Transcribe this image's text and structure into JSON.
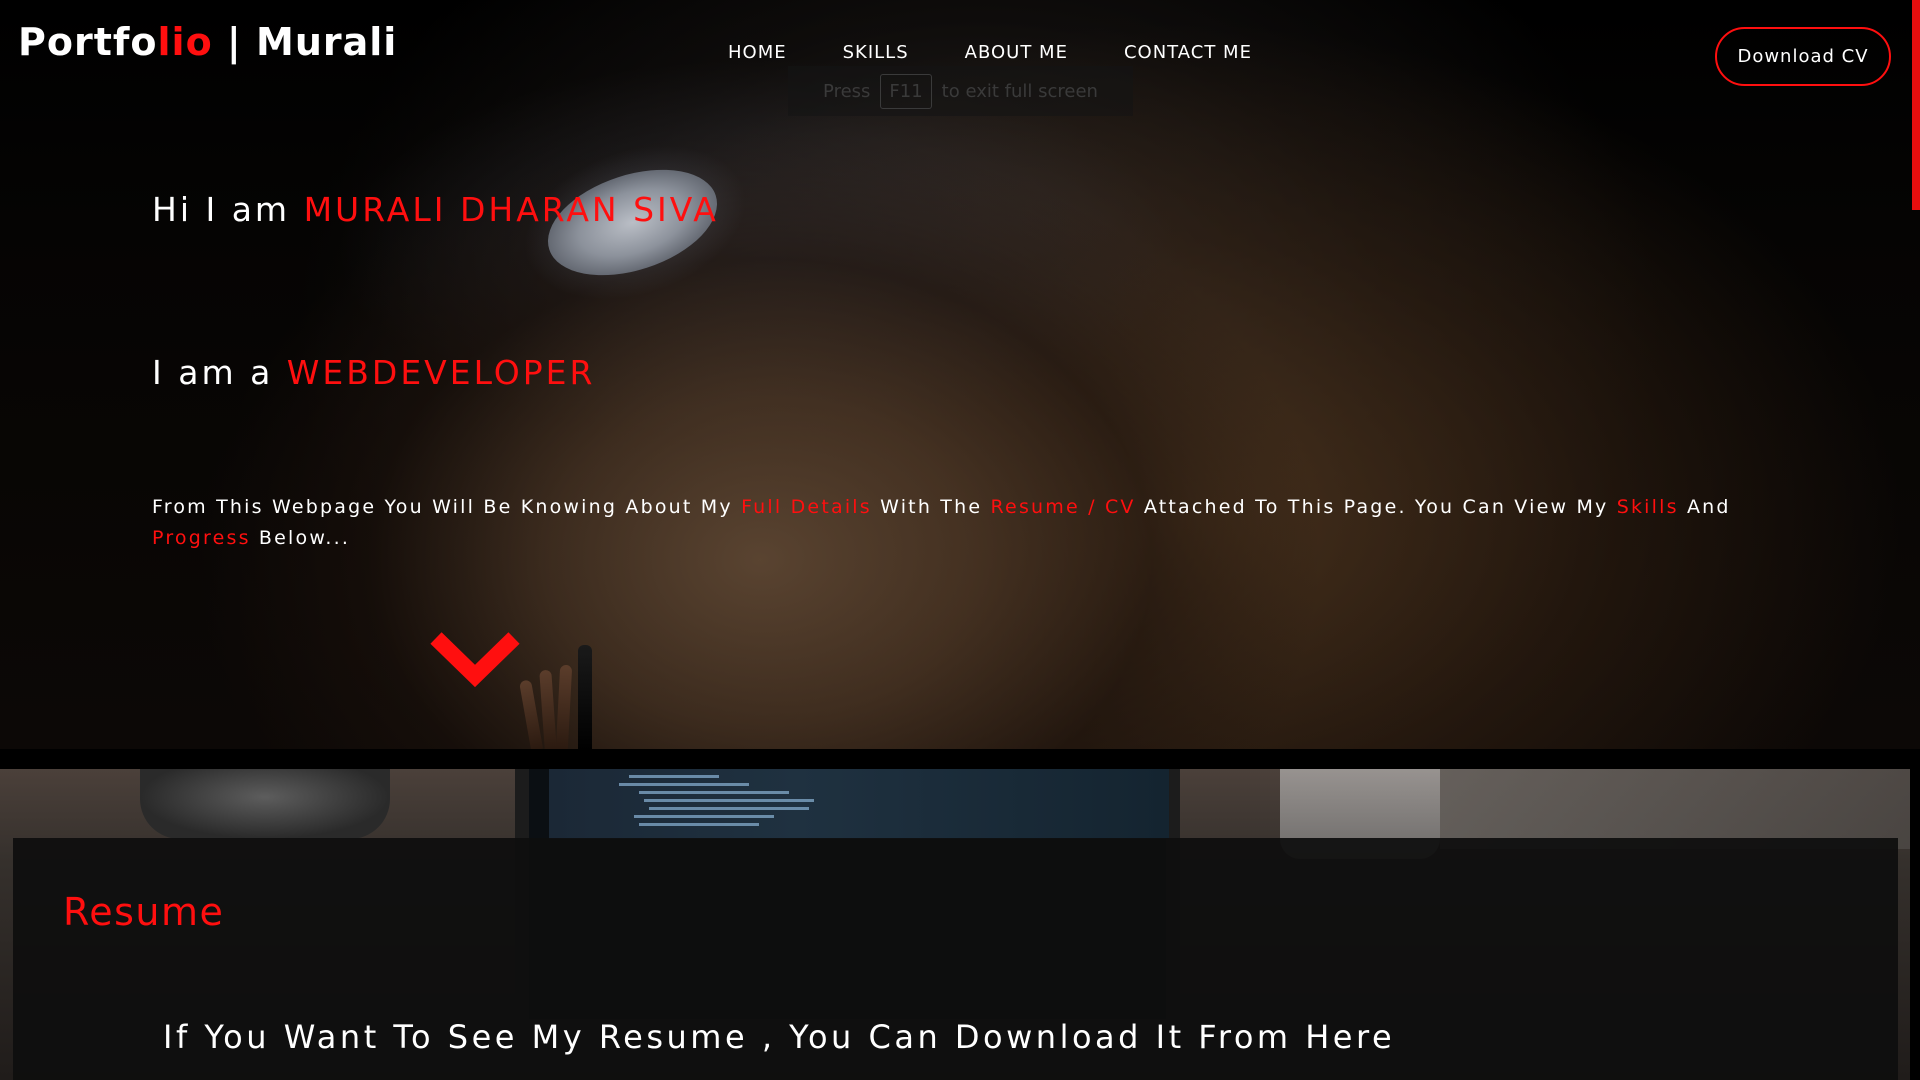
{
  "navbar": {
    "logo": {
      "part1": "Portfo",
      "part2": "lio",
      "part3": " | Murali"
    },
    "links": [
      "HOME",
      "SKILLS",
      "ABOUT ME",
      "CONTACT ME"
    ],
    "cv_button": "Download CV"
  },
  "fullscreen_hint": {
    "before": "Press",
    "key": "F11",
    "after": "to exit full screen"
  },
  "hero": {
    "greeting": {
      "prefix": "Hi I am ",
      "name": "MURALI DHARAN SIVA"
    },
    "role": {
      "prefix": "I am a ",
      "role": "WEBDEVELOPER"
    },
    "intro": {
      "t1": "From This Webpage You Will Be Knowing About My ",
      "h1": "Full Details",
      "t2": " With The ",
      "h2": "Resume / CV",
      "t3": " Attached To This Page. You Can View My ",
      "h3": "Skills",
      "t4": " And ",
      "h4": "Progress",
      "t5": " Below..."
    },
    "scroll_icon": "chevron-down-icon"
  },
  "resume": {
    "title": "Resume",
    "text": "If You Want To See My Resume , You Can Download It From Here"
  },
  "colors": {
    "accent": "#ff0f0f",
    "text": "#ffffff",
    "background": "#000000"
  }
}
